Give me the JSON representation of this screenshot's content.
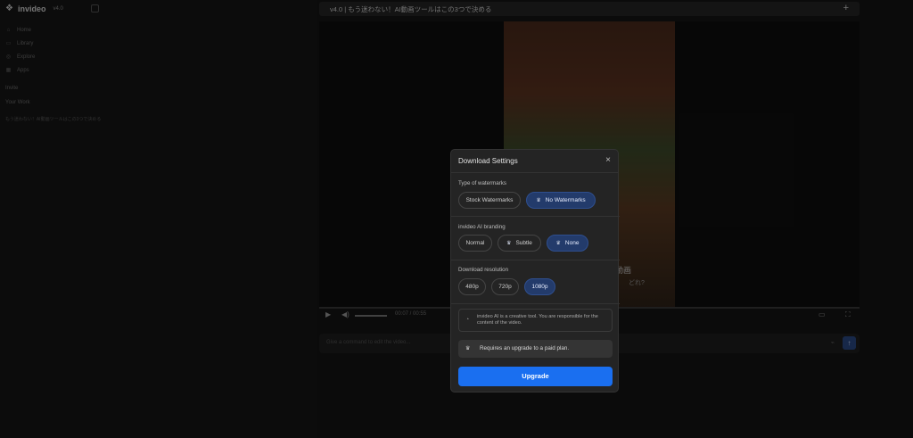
{
  "app": {
    "name": "invideo",
    "version": "v4.0"
  },
  "sidebar": {
    "items": [
      {
        "icon": "home-icon",
        "glyph": "⌂",
        "label": "Home"
      },
      {
        "icon": "library-icon",
        "glyph": "▭",
        "label": "Library"
      },
      {
        "icon": "explore-icon",
        "glyph": "◎",
        "label": "Explore"
      },
      {
        "icon": "apps-icon",
        "glyph": "▦",
        "label": "Apps"
      }
    ],
    "section_1": "Invite",
    "section_2": "Your Work",
    "recent": "もう迷わない！AI動画ツールはこの3つで決める"
  },
  "topbar": {
    "title": "v4.0 | もう迷わない！AI動画ツールはこの3つで決める",
    "add_label": "+"
  },
  "video": {
    "caption_1": "動画",
    "caption_2": "どれ?",
    "timecode": "00:07 / 00:55"
  },
  "prompt": {
    "placeholder": "Give a command to edit the video..."
  },
  "modal": {
    "title": "Download Settings",
    "close": "×",
    "watermark": {
      "title": "Type of watermarks",
      "options": [
        "Stock Watermarks",
        "No Watermarks"
      ],
      "selected": "No Watermarks"
    },
    "branding": {
      "title": "invideo AI branding",
      "options": [
        "Normal",
        "Subtle",
        "None"
      ],
      "selected": "None"
    },
    "resolution": {
      "title": "Download resolution",
      "options": [
        "480p",
        "720p",
        "1080p"
      ],
      "selected": "1080p"
    },
    "notice": "invideo AI is a creative tool. You are responsible for the content of the video.",
    "upgrade_note": "Requires an upgrade to a paid plan.",
    "upgrade_button": "Upgrade"
  },
  "colors": {
    "accent": "#1a6ff0",
    "selected_pill": "#233b6b"
  }
}
